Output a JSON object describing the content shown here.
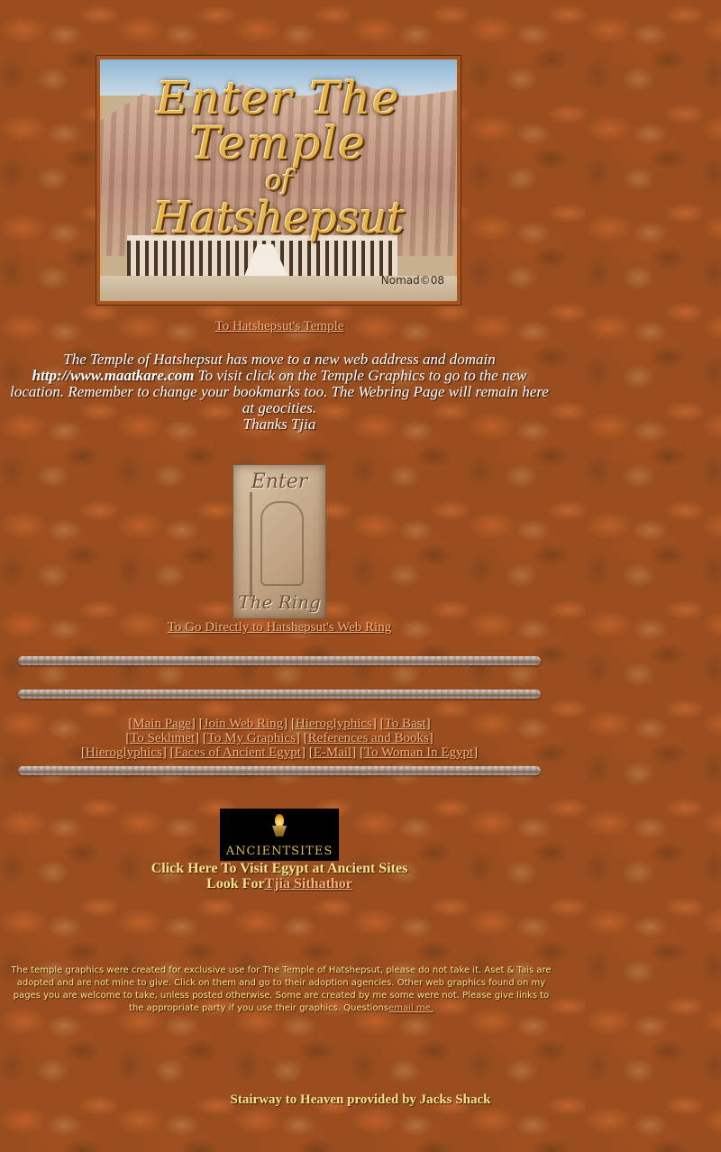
{
  "banner": {
    "title_line1": "Enter The Temple",
    "title_line2": "of",
    "title_line3": "Hatshepsut",
    "signature": "Nomad©08"
  },
  "temple_link": "To Hatshepsut's Temple",
  "notice": {
    "line1": "The Temple of Hatshepsut has move to a new web address and domain",
    "url": "http://www.maatkare.com",
    "line2": "To visit click on the Temple Graphics to go to the new location. Remember to change your bookmarks too. The Webring Page will remain here at geocities.",
    "thanks": "Thanks Tjia"
  },
  "ring_image": {
    "top_text": "Enter",
    "bottom_text": "The Ring"
  },
  "ring_link": "To Go Directly to Hatshepsut's Web Ring",
  "nav": {
    "row1": [
      "Main Page",
      "Join Web Ring",
      "Hieroglyphics",
      "To Bast"
    ],
    "row2": [
      "To Sekhmet",
      "To My Graphics",
      "References and Books"
    ],
    "row3": [
      "Hieroglyphics",
      "Faces of Ancient Egypt",
      "E-Mail",
      "To Woman In Egypt"
    ]
  },
  "ancient_sites": {
    "logo_text": "ANCIENTSITES",
    "visit_text": "Click Here To Visit Egypt at Ancient Sites",
    "look_for_prefix": "Look For",
    "look_for_link": "Tjia Sithathor"
  },
  "disclaimer": {
    "text": "The temple graphics were created for exclusive use for The Temple of Hatshepsut, please do not take it. Aset & Tais are adopted and are not mine to give. Click on them and go to their adoption agencies. Other web graphics found on my pages you are welcome to take, unless posted otherwise. Some are created by me some were not. Please give links to the appropriate party if you use their graphics. Questions",
    "email_link": "email me."
  },
  "footer": "Stairway to Heaven provided by Jacks Shack"
}
